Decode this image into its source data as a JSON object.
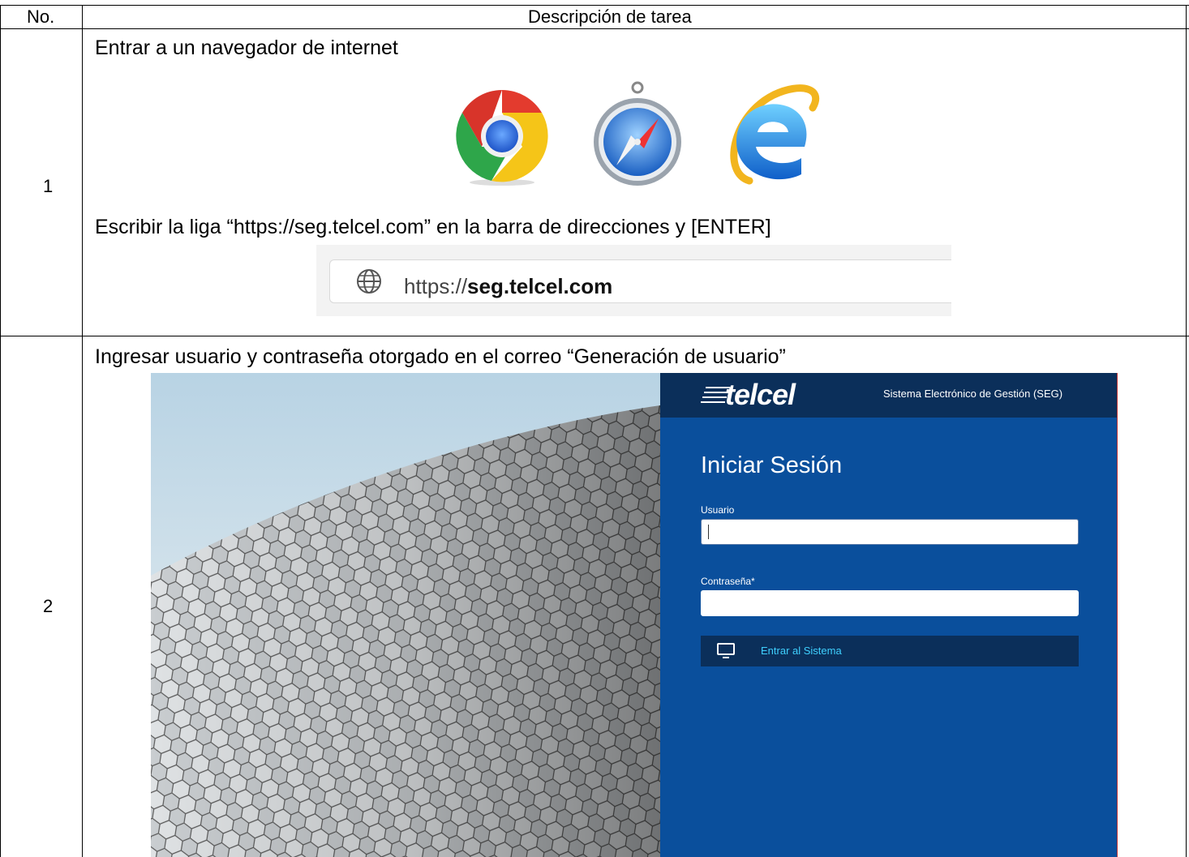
{
  "table": {
    "header": {
      "no": "No.",
      "description": "Descripción de tarea"
    },
    "rows": [
      {
        "number": "1",
        "step_open_browser": "Entrar a un navegador de internet",
        "browser_icons": [
          "chrome-icon",
          "safari-icon",
          "internet-explorer-icon"
        ],
        "step_enter_url": "Escribir la liga “https://seg.telcel.com” en la barra de direcciones y [ENTER]",
        "address_bar": {
          "url_prefix": "https://",
          "url_domain": "seg.telcel.com",
          "icon": "globe-icon"
        }
      },
      {
        "number": "2",
        "step_login": "Ingresar usuario y contraseña otorgado en el correo “Generación de usuario”",
        "login_screen": {
          "logo_text": "telcel",
          "system_title": "Sistema Electrónico de Gestión (SEG)",
          "form_title": "Iniciar Sesión",
          "username_label": "Usuario",
          "username_value": "",
          "password_label": "Contraseña*",
          "password_value": "",
          "submit_label": "Entrar al Sistema",
          "submit_icon": "monitor-icon"
        }
      }
    ]
  },
  "colors": {
    "panel_blue": "#0a4f9c",
    "panel_dark": "#0b2f5a",
    "button_text": "#3fd0ff"
  }
}
